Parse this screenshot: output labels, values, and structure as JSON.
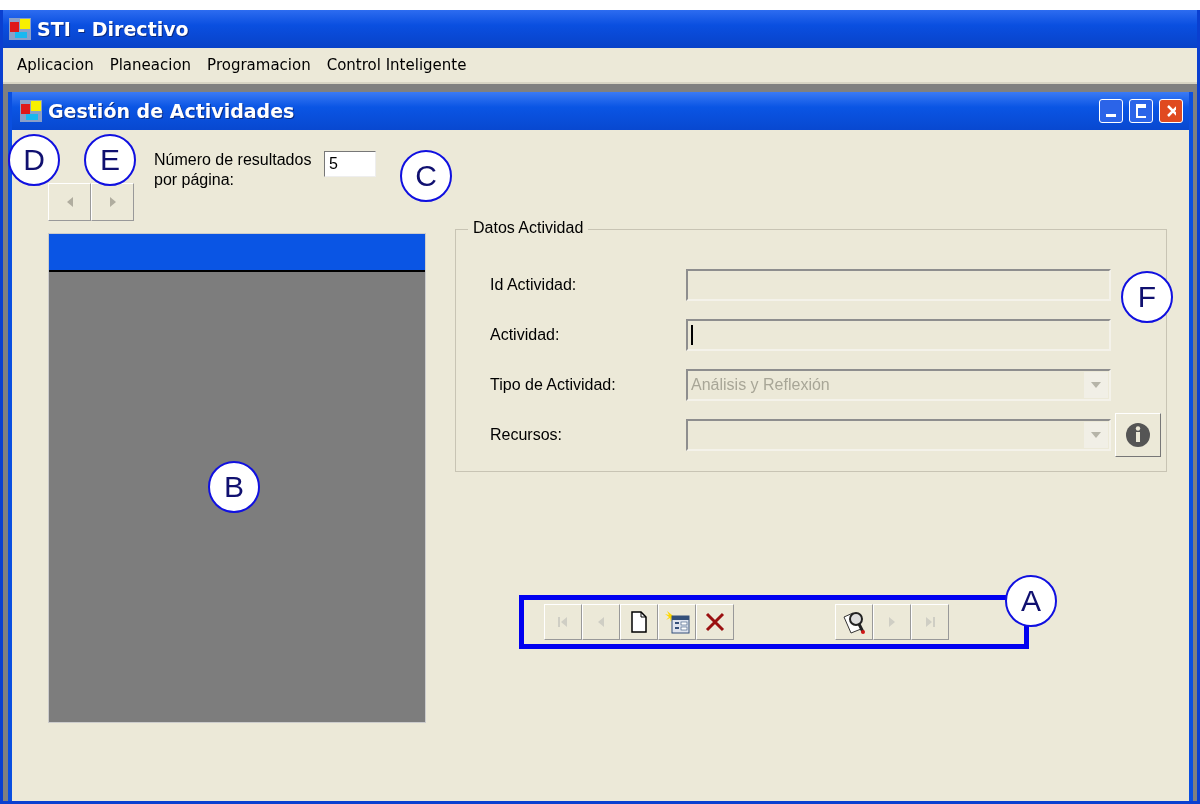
{
  "app_window": {
    "title": "STI - Directivo"
  },
  "menu": [
    "Aplicacion",
    "Planeacion",
    "Programacion",
    "Control Inteligente"
  ],
  "child_window": {
    "title": "Gestión de Actividades"
  },
  "pager": {
    "buttons": [
      {
        "kind": "prev",
        "disabled": true
      },
      {
        "kind": "next",
        "disabled": true
      }
    ],
    "label": "Número de resultados por página:",
    "value": "5"
  },
  "group": {
    "title": "Datos Actividad",
    "fields": [
      {
        "label": "Id Actividad:",
        "kind": "text",
        "caret": false
      },
      {
        "label": "Actividad:",
        "kind": "text",
        "caret": true
      },
      {
        "label": "Tipo de Actividad:",
        "kind": "combo",
        "disabled": true,
        "value": "Análisis y Reflexión"
      },
      {
        "label": "Recursos:",
        "kind": "combo",
        "disabled": true,
        "info": true
      }
    ]
  },
  "toolbar": [
    {
      "kind": "first",
      "disabled": true
    },
    {
      "kind": "prev",
      "disabled": true
    },
    {
      "kind": "new",
      "disabled": false
    },
    {
      "kind": "new-form",
      "disabled": false
    },
    {
      "kind": "delete",
      "disabled": false
    },
    {
      "kind": "gap"
    },
    {
      "kind": "search",
      "disabled": false
    },
    {
      "kind": "next",
      "disabled": true
    },
    {
      "kind": "last",
      "disabled": true
    }
  ],
  "annotations": [
    "D",
    "E",
    "C",
    "B",
    "F",
    "A"
  ]
}
